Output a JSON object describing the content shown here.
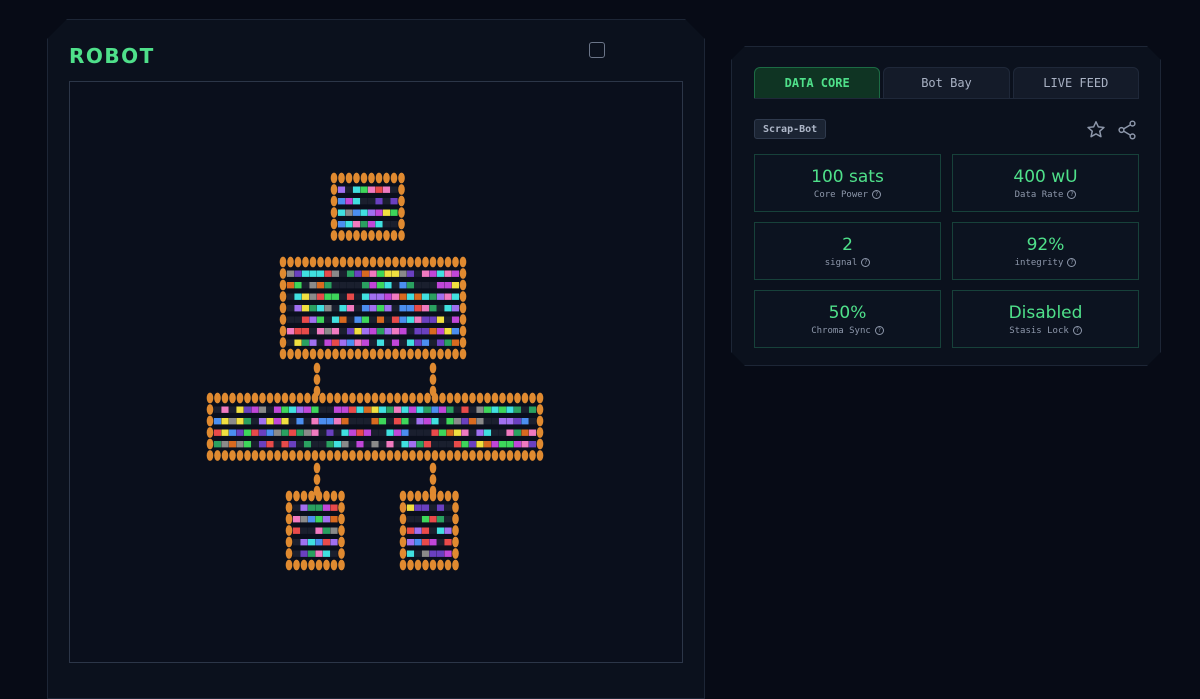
{
  "left": {
    "title": "ROBOT",
    "pixel_colors": {
      "frame": "#e08a30",
      "palette": [
        "#3dd65a",
        "#c046d8",
        "#4b8ef0",
        "#e84a4a",
        "#f0e040",
        "#40e0e0",
        "#a070f0",
        "#f07ac0",
        "#8a8a8a",
        "#2aa060",
        "#d86a20",
        "#6a40c0"
      ]
    }
  },
  "tabs": [
    {
      "label": "DATA CORE",
      "active": true
    },
    {
      "label": "Bot Bay",
      "active": false
    },
    {
      "label": "LIVE FEED",
      "active": false
    }
  ],
  "badge": "Scrap-Bot",
  "icons": {
    "favorite": "star-icon",
    "share": "share-icon"
  },
  "stats": [
    {
      "value": "100 sats",
      "label": "Core Power"
    },
    {
      "value": "400 wU",
      "label": "Data Rate"
    },
    {
      "value": "2",
      "label": "signal"
    },
    {
      "value": "92%",
      "label": "integrity"
    },
    {
      "value": "50%",
      "label": "Chroma Sync"
    },
    {
      "value": "Disabled",
      "label": "Stasis Lock"
    }
  ],
  "colors": {
    "accent": "#4fe08a",
    "background": "#070b16",
    "panel": "#0b111d"
  }
}
